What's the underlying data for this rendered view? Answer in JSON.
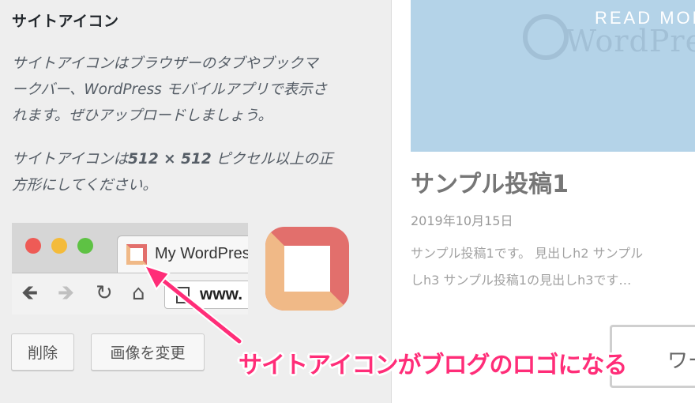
{
  "customizer": {
    "section_title": "サイトアイコン",
    "description_lines": [
      "サイトアイコンはブラウザーのタブやブックマ",
      "ークバー、WordPress モバイルアプリで表示さ",
      "れます。ぜひアップロードしましょう。"
    ],
    "size_note_prefix": "サイトアイコンは",
    "size_note_bold": "512 × 512",
    "size_note_suffix": " ピクセル以上の正",
    "size_note_line2": "方形にしてください。",
    "remove_button": "削除",
    "change_button": "画像を変更"
  },
  "browser_preview": {
    "tab_title": "My WordPress",
    "url": "www.",
    "icons": [
      "back-arrow-icon",
      "forward-arrow-icon",
      "reload-icon",
      "home-icon",
      "page-icon"
    ]
  },
  "annotation": {
    "text": "サイトアイコンがブログのロゴになる",
    "color": "#ff2d78"
  },
  "preview": {
    "read_more": "READ MORE",
    "watermark": "WordPress",
    "post_title": "サンプル投稿1",
    "post_date": "2019年10月15日",
    "excerpt_lines": [
      "サンプル投稿1です。 見出しh2 サンプル",
      "しh3 サンプル投稿1の見出しh3です…"
    ],
    "search_text": "ワー"
  },
  "colors": {
    "icon_coral": "#e26f6c",
    "icon_peach": "#f0b987",
    "annotation_pink": "#ff2d78",
    "hero_blue": "#b4d3e8"
  }
}
